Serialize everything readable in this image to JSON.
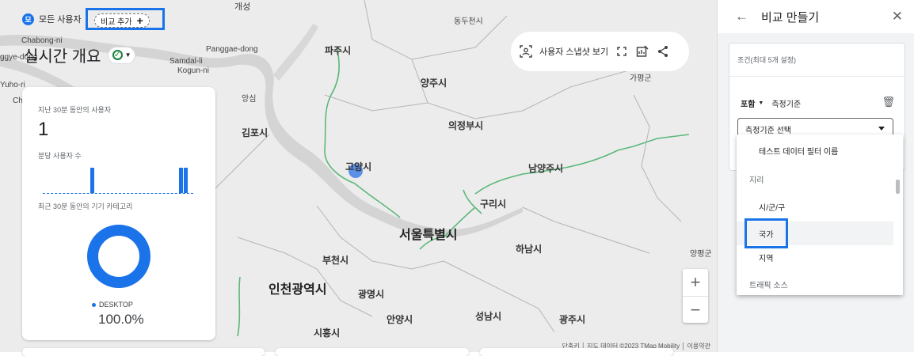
{
  "map": {
    "cities": {
      "kaesong": "개성",
      "dongducheon": "동두천시",
      "chabong": "Chabong-ni",
      "gyeyang": "ggye-dong",
      "panggae": "Panggae-dong",
      "paju": "파주시",
      "samdal": "Samdal-li",
      "kogun": "Kogun-ni",
      "yuho": "Yuho-ri",
      "ch": "Ch",
      "oksan": "앙심",
      "yangju": "양주시",
      "gapyeong": "가평군",
      "gimpo": "김포시",
      "uijeongbu": "의정부시",
      "goyang": "고양시",
      "namyangju": "남양주시",
      "guri": "구리시",
      "seoul": "서울특별시",
      "bucheon": "부천시",
      "hanam": "하남시",
      "yangpyeong": "양평군",
      "incheon": "인천광역시",
      "gwangmyeong": "광명시",
      "anyang": "안양시",
      "seongnam": "성남시",
      "gwangju": "광주시",
      "siheung": "시흥시"
    },
    "footer": "단축키 │ 지도 데이터 ©2023 TMap Mobility │ 이용약관"
  },
  "segment": {
    "badge": "모",
    "label": "모든 사용자"
  },
  "add_comparison": {
    "label": "비교 추가",
    "icon": "plus-icon"
  },
  "page_title": "실시간 개요",
  "toolbar": {
    "snapshot_label": "사용자 스냅샷 보기"
  },
  "zoom": {
    "in": "+",
    "out": "−"
  },
  "realtime_card": {
    "users_label": "지난 30분 동안의 사용자",
    "users_value": "1",
    "per_minute_label": "분당 사용자 수",
    "device_label": "최근 30분 동안의 기기 카테고리",
    "legend": "DESKTOP",
    "percent": "100.0%",
    "accent": "#1a73e8"
  },
  "panel": {
    "title": "비교 만들기",
    "conditions_header": "조건(최대 5개 설정)",
    "include_label": "포함",
    "dimension_label": "측정기준",
    "select_placeholder": "측정기준 선택"
  },
  "dropdown": {
    "items": [
      {
        "text": "테스트 데이터 필터 이름",
        "kind": "option"
      },
      {
        "text": "지리",
        "kind": "group"
      },
      {
        "text": "시/군/구",
        "kind": "option"
      },
      {
        "text": "국가",
        "kind": "option"
      },
      {
        "text": "지역",
        "kind": "option"
      },
      {
        "text": "트래픽 소스",
        "kind": "group"
      }
    ]
  }
}
